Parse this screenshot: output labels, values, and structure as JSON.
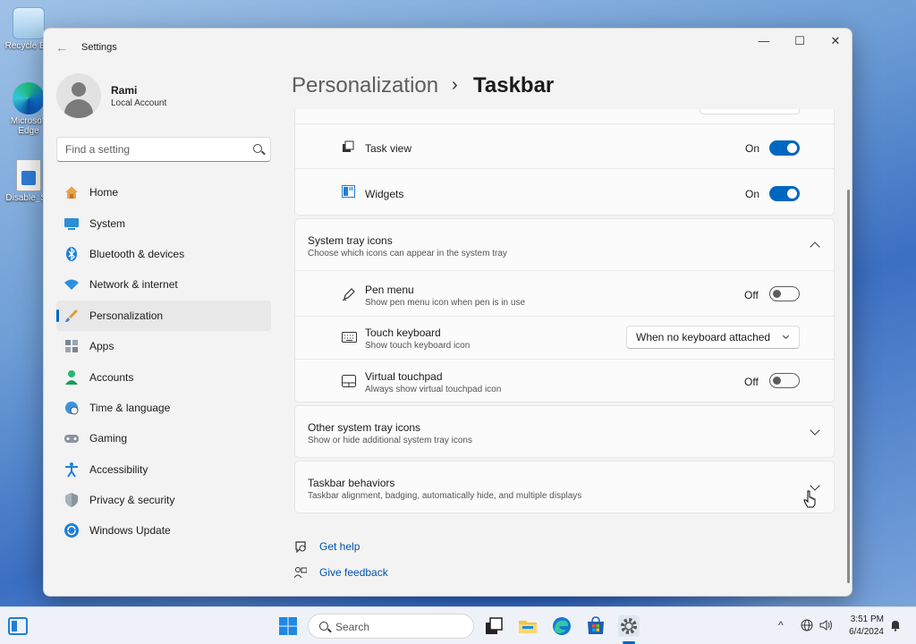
{
  "desktop": {
    "icons": [
      {
        "label": "Recycle Bin",
        "name": "recycle-bin-icon"
      },
      {
        "label": "Microsoft Edge",
        "name": "edge-icon"
      },
      {
        "label": "Disable_Sh",
        "name": "script-file-icon"
      }
    ]
  },
  "window": {
    "title": "Settings",
    "controls": {
      "minimize": "—",
      "maximize": "☐",
      "close": "✕"
    }
  },
  "user": {
    "name": "Rami",
    "account_type": "Local Account"
  },
  "search": {
    "placeholder": "Find a setting"
  },
  "nav": {
    "items": [
      {
        "label": "Home"
      },
      {
        "label": "System"
      },
      {
        "label": "Bluetooth & devices"
      },
      {
        "label": "Network & internet"
      },
      {
        "label": "Personalization"
      },
      {
        "label": "Apps"
      },
      {
        "label": "Accounts"
      },
      {
        "label": "Time & language"
      },
      {
        "label": "Gaming"
      },
      {
        "label": "Accessibility"
      },
      {
        "label": "Privacy & security"
      },
      {
        "label": "Windows Update"
      }
    ],
    "active_index": 4
  },
  "breadcrumb": {
    "parent": "Personalization",
    "separator": "›",
    "current": "Taskbar"
  },
  "taskbar_items": {
    "task_view": {
      "label": "Task view",
      "state": "On"
    },
    "widgets": {
      "label": "Widgets",
      "state": "On"
    }
  },
  "system_tray": {
    "title": "System tray icons",
    "subtitle": "Choose which icons can appear in the system tray",
    "pen_menu": {
      "title": "Pen menu",
      "subtitle": "Show pen menu icon when pen is in use",
      "state": "Off"
    },
    "touch_keyboard": {
      "title": "Touch keyboard",
      "subtitle": "Show touch keyboard icon",
      "value": "When no keyboard attached"
    },
    "virtual_touchpad": {
      "title": "Virtual touchpad",
      "subtitle": "Always show virtual touchpad icon",
      "state": "Off"
    }
  },
  "other_tray": {
    "title": "Other system tray icons",
    "subtitle": "Show or hide additional system tray icons"
  },
  "behaviors": {
    "title": "Taskbar behaviors",
    "subtitle": "Taskbar alignment, badging, automatically hide, and multiple displays"
  },
  "links": {
    "help": "Get help",
    "feedback": "Give feedback"
  },
  "os_taskbar": {
    "search_label": "Search",
    "time": "3:51 PM",
    "date": "6/4/2024",
    "tray_chevron": "^"
  },
  "colors": {
    "accent": "#0067c0",
    "link": "#0053a6"
  }
}
